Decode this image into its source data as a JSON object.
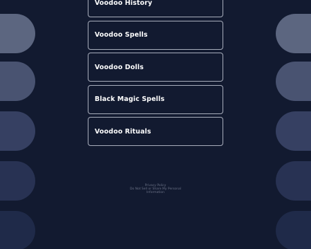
{
  "links": [
    "Voodoo History",
    "Voodoo Spells",
    "Voodoo Dolls",
    "Black Magic Spells",
    "Voodoo Rituals"
  ],
  "footer": {
    "privacy": "Privacy Policy",
    "do_not_sell_line1": "Do Not Sell or Share My Personal",
    "do_not_sell_line2": "Information"
  },
  "colors": {
    "background": "#121a30",
    "link_border": "#a9afbd",
    "link_text": "#ffffff",
    "footer_text": "#6b7286"
  }
}
